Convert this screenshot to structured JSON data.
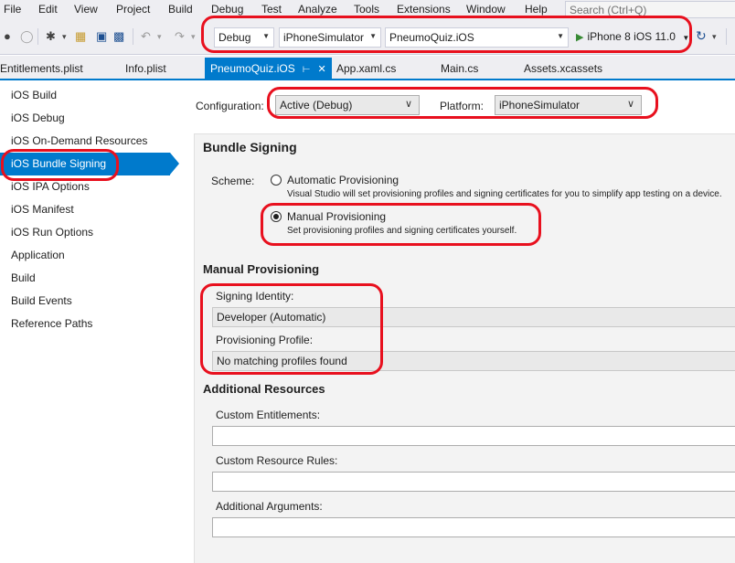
{
  "menu": [
    "File",
    "Edit",
    "View",
    "Project",
    "Build",
    "Debug",
    "Test",
    "Analyze",
    "Tools",
    "Extensions",
    "Window",
    "Help"
  ],
  "search": {
    "placeholder": "Search (Ctrl+Q)"
  },
  "toolbar": {
    "configuration": "Debug",
    "platform": "iPhoneSimulator",
    "project": "PneumoQuiz.iOS",
    "run_target": "iPhone 8 iOS 11.0"
  },
  "tabs": [
    {
      "label": "Entitlements.plist"
    },
    {
      "label": "Info.plist"
    },
    {
      "label": "PneumoQuiz.iOS",
      "active": true
    },
    {
      "label": "App.xaml.cs"
    },
    {
      "label": "Main.cs"
    },
    {
      "label": "Assets.xcassets"
    }
  ],
  "sidebar": {
    "items": [
      {
        "label": "iOS Build"
      },
      {
        "label": "iOS Debug"
      },
      {
        "label": "iOS On-Demand Resources"
      },
      {
        "label": "iOS Bundle Signing",
        "selected": true
      },
      {
        "label": "iOS IPA Options"
      },
      {
        "label": "iOS Manifest"
      },
      {
        "label": "iOS Run Options"
      },
      {
        "label": "Application"
      },
      {
        "label": "Build"
      },
      {
        "label": "Build Events"
      },
      {
        "label": "Reference Paths"
      }
    ]
  },
  "config_bar": {
    "configuration_label": "Configuration:",
    "configuration_value": "Active (Debug)",
    "platform_label": "Platform:",
    "platform_value": "iPhoneSimulator"
  },
  "bundle_signing": {
    "title": "Bundle Signing",
    "scheme_label": "Scheme:",
    "auto_label": "Automatic Provisioning",
    "auto_desc": "Visual Studio will set provisioning profiles and signing certificates for you to simplify app testing on a device.",
    "manual_label": "Manual Provisioning",
    "manual_desc": "Set provisioning profiles and signing certificates yourself.",
    "selected_scheme": "manual"
  },
  "manual_provisioning": {
    "title": "Manual Provisioning",
    "signing_identity_label": "Signing Identity:",
    "signing_identity_value": "Developer (Automatic)",
    "provisioning_profile_label": "Provisioning Profile:",
    "provisioning_profile_value": "No matching profiles found"
  },
  "additional_resources": {
    "title": "Additional Resources",
    "custom_entitlements_label": "Custom Entitlements:",
    "custom_entitlements_value": "",
    "custom_resource_rules_label": "Custom Resource Rules:",
    "custom_resource_rules_value": "",
    "additional_arguments_label": "Additional Arguments:",
    "additional_arguments_value": ""
  },
  "colors": {
    "accent": "#007acc",
    "annotation": "#e8101e",
    "chrome": "#eeeef2",
    "panel": "#f3f3f3"
  }
}
